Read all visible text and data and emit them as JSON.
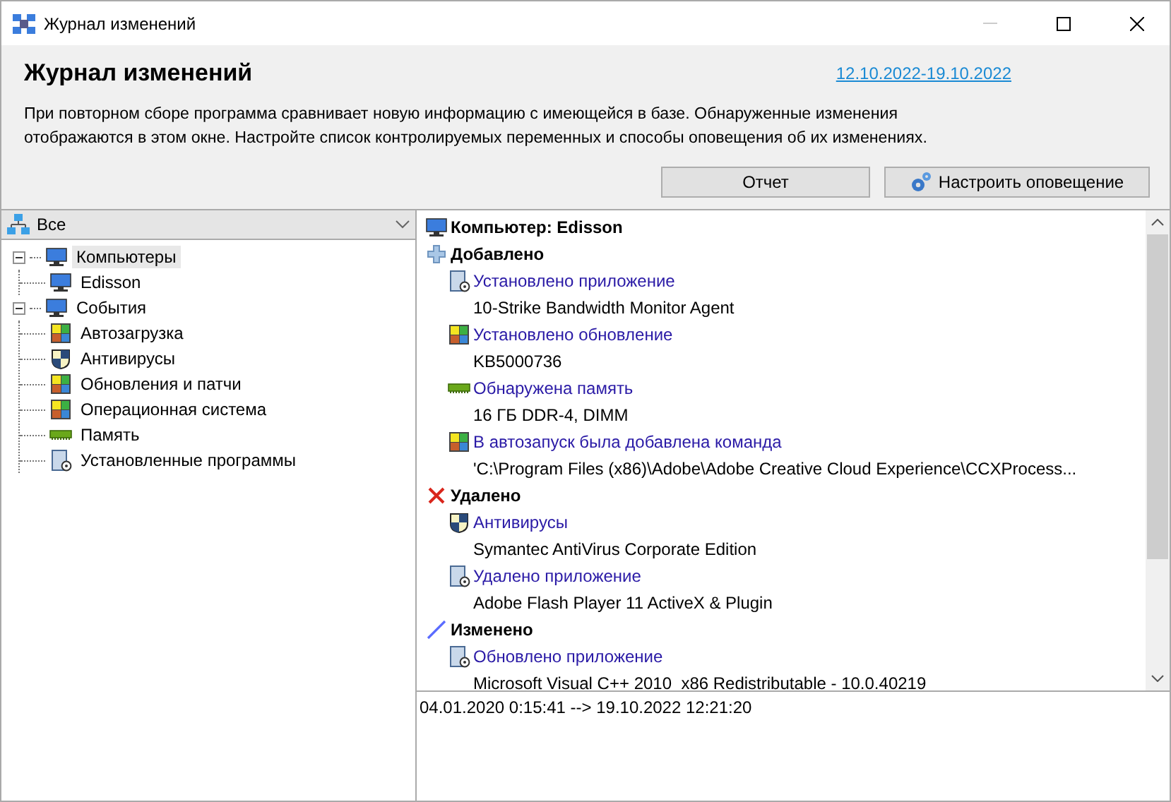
{
  "window": {
    "title": "Журнал изменений"
  },
  "header": {
    "title": "Журнал изменений",
    "date_range": "12.10.2022-19.10.2022",
    "description": "При повторном сборе программа сравнивает новую информацию с имеющейся в базе. Обнаруженные изменения отображаются в этом окне. Настройте список контролируемых переменных и способы оповещения об их изменениях.",
    "buttons": [
      {
        "label": "Отчет",
        "kind": "plain"
      },
      {
        "label": "Настроить оповещение",
        "kind": "settings"
      }
    ]
  },
  "filter": {
    "value": "Все"
  },
  "tree": [
    {
      "label": "Компьютеры",
      "kind": "computer",
      "expanded": true,
      "selected": true,
      "children": [
        {
          "label": "Edisson",
          "kind": "computer",
          "selected": false
        }
      ]
    },
    {
      "label": "События",
      "kind": "computer",
      "expanded": true,
      "selected": false,
      "children": [
        {
          "label": "Автозагрузка",
          "kind": "tiles",
          "selected": false
        },
        {
          "label": "Антивирусы",
          "kind": "shield",
          "selected": false
        },
        {
          "label": "Обновления и патчи",
          "kind": "tiles",
          "selected": false
        },
        {
          "label": "Операционная система",
          "kind": "tiles",
          "selected": false
        },
        {
          "label": "Память",
          "kind": "memory",
          "selected": false
        },
        {
          "label": "Установленные программы",
          "kind": "app",
          "selected": false
        }
      ]
    }
  ],
  "log": [
    {
      "kind": "computer",
      "text": "Компьютер: Edisson"
    },
    {
      "kind": "added",
      "text": "Добавлено"
    },
    {
      "kind": "app",
      "text": "Установлено приложение"
    },
    {
      "kind": "value",
      "text": "10-Strike Bandwidth Monitor Agent"
    },
    {
      "kind": "update",
      "text": "Установлено обновление"
    },
    {
      "kind": "value",
      "text": "KB5000736"
    },
    {
      "kind": "memory",
      "text": "Обнаружена память"
    },
    {
      "kind": "value",
      "text": "16 ГБ DDR-4, DIMM"
    },
    {
      "kind": "update",
      "text": "В автозапуск была добавлена команда"
    },
    {
      "kind": "value",
      "text": "'C:\\Program Files (x86)\\Adobe\\Adobe Creative Cloud Experience\\CCXProcess..."
    },
    {
      "kind": "removed",
      "text": "Удалено"
    },
    {
      "kind": "antivirus",
      "text": "Антивирусы"
    },
    {
      "kind": "value",
      "text": "Symantec AntiVirus Corporate Edition"
    },
    {
      "kind": "app",
      "text": "Удалено приложение"
    },
    {
      "kind": "value",
      "text": "Adobe Flash Player 11 ActiveX & Plugin"
    },
    {
      "kind": "changed",
      "text": "Изменено"
    },
    {
      "kind": "app",
      "text": "Обновлено приложение"
    },
    {
      "kind": "value",
      "text": "Microsoft Visual C++ 2010  x86 Redistributable - 10.0.40219"
    }
  ],
  "details": {
    "text": "04.01.2020 0:15:41 --> 19.10.2022 12:21:20"
  }
}
